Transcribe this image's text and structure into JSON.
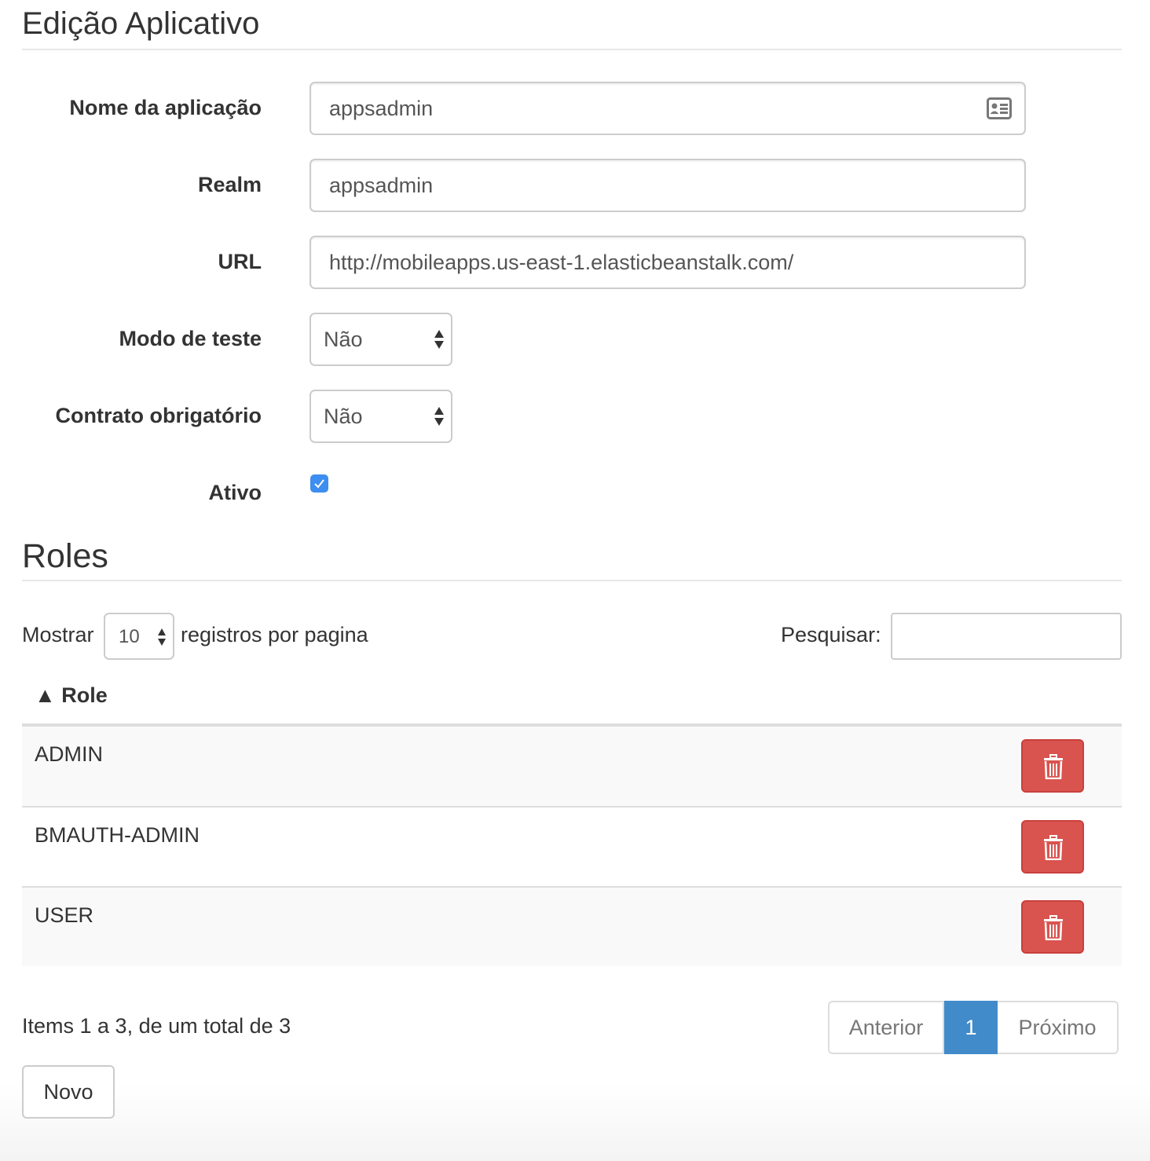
{
  "page": {
    "title": "Edição Aplicativo"
  },
  "form": {
    "app_name_label": "Nome da aplicação",
    "app_name_value": "appsadmin",
    "realm_label": "Realm",
    "realm_value": "appsadmin",
    "url_label": "URL",
    "url_value": "http://mobileapps.us-east-1.elasticbeanstalk.com/",
    "test_mode_label": "Modo de teste",
    "test_mode_value": "Não",
    "contract_label": "Contrato obrigatório",
    "contract_value": "Não",
    "active_label": "Ativo",
    "active_checked": true
  },
  "roles": {
    "heading": "Roles",
    "show_label": "Mostrar",
    "page_size": "10",
    "per_page_label": "registros por pagina",
    "search_label": "Pesquisar:",
    "search_value": "",
    "column_header": "▲ Role",
    "rows": [
      {
        "role": "ADMIN"
      },
      {
        "role": "BMAUTH-ADMIN"
      },
      {
        "role": "USER"
      }
    ],
    "summary": "Items 1 a 3, de um total de 3",
    "pagination": {
      "prev": "Anterior",
      "current": "1",
      "next": "Próximo"
    },
    "new_button": "Novo"
  },
  "icons": {
    "id_card": "id-card-icon",
    "trash": "trash-icon",
    "select_arrows": "sort-arrows-icon",
    "check": "check-icon"
  },
  "colors": {
    "danger": "#d9534f",
    "primary": "#428bca",
    "checkbox": "#3d8ef0"
  }
}
